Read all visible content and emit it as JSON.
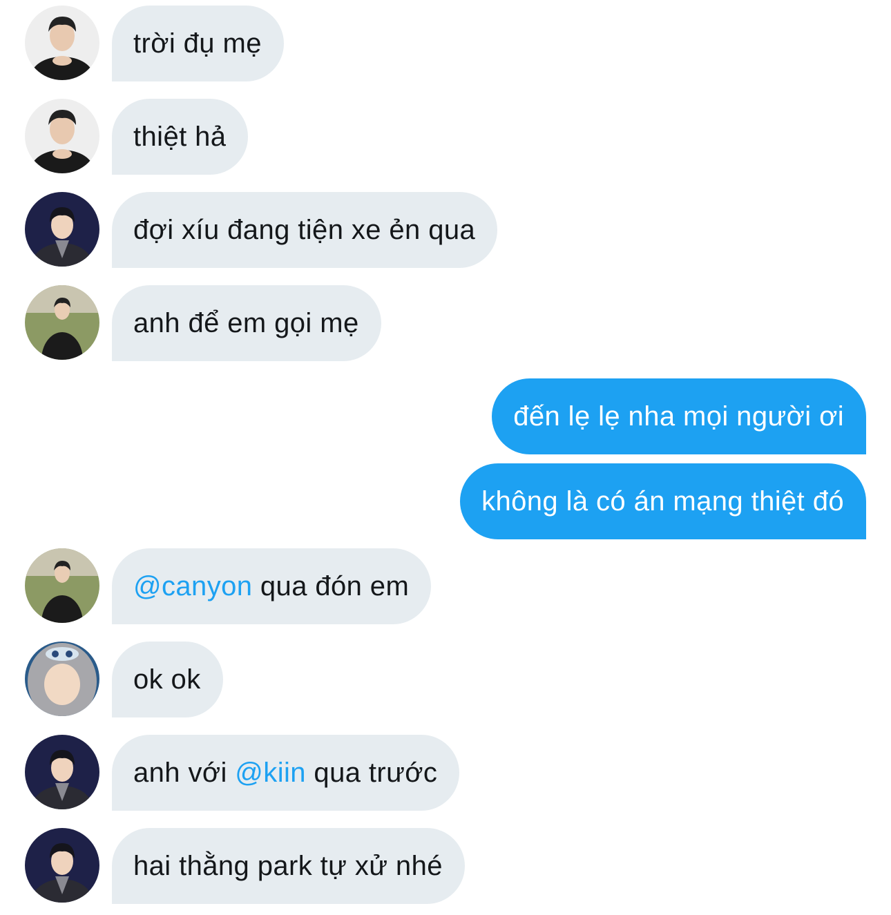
{
  "colors": {
    "incoming_bubble": "#e6ecf0",
    "outgoing_bubble": "#1da1f2",
    "mention": "#1da1f2",
    "text": "#14171a"
  },
  "messages": [
    {
      "direction": "in",
      "avatar": "user-a-avatar",
      "text": "trời đụ mẹ"
    },
    {
      "direction": "in",
      "avatar": "user-a-avatar",
      "text": "thiệt hả"
    },
    {
      "direction": "in",
      "avatar": "user-b-avatar",
      "text": "đợi xíu đang tiện xe ẻn qua"
    },
    {
      "direction": "in",
      "avatar": "user-c-avatar",
      "text": "anh để em gọi mẹ"
    },
    {
      "direction": "out",
      "text": "đến lẹ lẹ nha mọi người ơi"
    },
    {
      "direction": "out",
      "text": "không là có án mạng thiệt đó"
    },
    {
      "direction": "in",
      "avatar": "user-c-avatar",
      "mention": "@canyon",
      "text_after": " qua đón em"
    },
    {
      "direction": "in",
      "avatar": "user-d-avatar",
      "text": "ok ok"
    },
    {
      "direction": "in",
      "avatar": "user-b-avatar",
      "text_before": "anh với ",
      "mention": "@kiin",
      "text_after": " qua trước"
    },
    {
      "direction": "in",
      "avatar": "user-b-avatar",
      "text": "hai thằng park tự xử nhé"
    }
  ]
}
